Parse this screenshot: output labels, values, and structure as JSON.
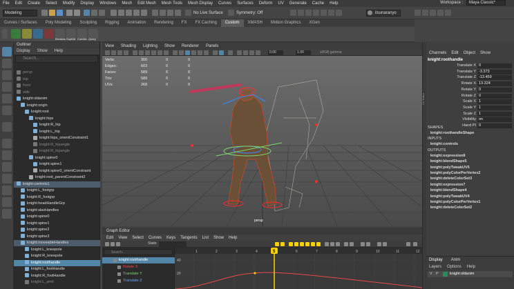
{
  "menubar": {
    "items": [
      "File",
      "Edit",
      "Create",
      "Select",
      "Modify",
      "Display",
      "Windows",
      "Mesh",
      "Edit Mesh",
      "Mesh Tools",
      "Mesh Display",
      "Curves",
      "Surfaces",
      "Deform",
      "UV",
      "Generate",
      "Cache",
      "Help"
    ],
    "workspace_label": "Workspace :",
    "workspace_value": "Maya Classic*"
  },
  "statusline": {
    "mode": "Modeling",
    "live_surface": "No Live Surface",
    "symmetry": "Symmetry: Off",
    "user": "ilsunaranyo"
  },
  "shelf": {
    "tabs": [
      "Curves / Surfaces",
      "Poly Modeling",
      "Sculpting",
      "Rigging",
      "Animation",
      "Rendering",
      "FX",
      "FX Caching",
      "Custom",
      "XMASH",
      "Motion Graphics",
      "XGen"
    ],
    "active_tab": "Custom",
    "icon_labels": [
      "Breakdn",
      "SoptAtt",
      "Combin",
      "Query"
    ]
  },
  "outliner": {
    "title": "Outliner",
    "menu": [
      "Display",
      "Show",
      "Help"
    ],
    "search_placeholder": "Search...",
    "rows": [
      {
        "label": "persp",
        "indent": 0,
        "state": "dim",
        "color": "#777"
      },
      {
        "label": "top",
        "indent": 0,
        "state": "dim",
        "color": "#777"
      },
      {
        "label": "front",
        "indent": 0,
        "state": "dim",
        "color": "#777"
      },
      {
        "label": "side",
        "indent": 0,
        "state": "dim",
        "color": "#777"
      },
      {
        "label": "knight:oldanim",
        "indent": 0,
        "state": "",
        "color": "#7fb0d8"
      },
      {
        "label": "knight:origin",
        "indent": 1,
        "state": "",
        "color": "#7fb0d8"
      },
      {
        "label": "knight:root",
        "indent": 2,
        "state": "",
        "color": "#7fb0d8"
      },
      {
        "label": "knight:hips",
        "indent": 3,
        "state": "",
        "color": "#7fb0d8"
      },
      {
        "label": "knight:R_hip",
        "indent": 4,
        "state": "",
        "color": "#7fb0d8"
      },
      {
        "label": "knight:L_hip",
        "indent": 4,
        "state": "",
        "color": "#7fb0d8"
      },
      {
        "label": "knight:hips_orientConstraint1",
        "indent": 4,
        "state": "",
        "color": "#aaa"
      },
      {
        "label": "knight:R_hipangle",
        "indent": 4,
        "state": "dim",
        "color": "#777"
      },
      {
        "label": "knight:R_hipangle",
        "indent": 4,
        "state": "dim",
        "color": "#777"
      },
      {
        "label": "knight:spine0",
        "indent": 3,
        "state": "",
        "color": "#7fb0d8"
      },
      {
        "label": "knight:spine1",
        "indent": 4,
        "state": "",
        "color": "#7fb0d8"
      },
      {
        "label": "knight:spine0_orientConstraint",
        "indent": 4,
        "state": "",
        "color": "#aaa"
      },
      {
        "label": "knight:root_parentConstraint2",
        "indent": 3,
        "state": "",
        "color": "#aaa"
      },
      {
        "label": "knight:controls1",
        "indent": 0,
        "state": "hl",
        "color": "#7fb0d8"
      },
      {
        "label": "knight:L_footgrp",
        "indent": 1,
        "state": "",
        "color": "#7fb0d8"
      },
      {
        "label": "knight:R_footgrp",
        "indent": 1,
        "state": "",
        "color": "#7fb0d8"
      },
      {
        "label": "knight:headHandleGrp",
        "indent": 1,
        "state": "",
        "color": "#7fb0d8"
      },
      {
        "label": "knight:slavHandles",
        "indent": 1,
        "state": "",
        "color": "#7fb0d8"
      },
      {
        "label": "knight:spine0",
        "indent": 1,
        "state": "",
        "color": "#7fb0d8"
      },
      {
        "label": "knight:spine1",
        "indent": 1,
        "state": "",
        "color": "#7fb0d8"
      },
      {
        "label": "knight:spine2",
        "indent": 1,
        "state": "",
        "color": "#7fb0d8"
      },
      {
        "label": "knight:spine3",
        "indent": 1,
        "state": "",
        "color": "#7fb0d8"
      },
      {
        "label": "knight:moveableHandles",
        "indent": 1,
        "state": "hl",
        "color": "#7fb0d8"
      },
      {
        "label": "knight:L_kneepole",
        "indent": 2,
        "state": "",
        "color": "#7fb0d8"
      },
      {
        "label": "knight:R_kneepole",
        "indent": 2,
        "state": "",
        "color": "#7fb0d8"
      },
      {
        "label": "knight:roothandle",
        "indent": 2,
        "state": "sel",
        "color": "#7fb0d8"
      },
      {
        "label": "knight:L_footHandle",
        "indent": 2,
        "state": "",
        "color": "#7fb0d8"
      },
      {
        "label": "knight:R_footHandle",
        "indent": 2,
        "state": "",
        "color": "#7fb0d8"
      },
      {
        "label": "knight:L_amtl",
        "indent": 2,
        "state": "dim",
        "color": "#777"
      }
    ]
  },
  "viewport": {
    "menu": [
      "View",
      "Shading",
      "Lighting",
      "Show",
      "Renderer",
      "Panels"
    ],
    "color_space": "sRGB gamma",
    "field_a": "0.00",
    "field_b": "1.00",
    "hud": [
      {
        "label": "Verts:",
        "a": "300",
        "b": "0",
        "c": "0"
      },
      {
        "label": "Edges:",
        "a": "603",
        "b": "0",
        "c": "0"
      },
      {
        "label": "Faces:",
        "a": "589",
        "b": "0",
        "c": "0"
      },
      {
        "label": "Tris:",
        "a": "589",
        "b": "0",
        "c": "0"
      },
      {
        "label": "UVs:",
        "a": "268",
        "b": "0",
        "c": "0"
      }
    ],
    "camera": "persp"
  },
  "graph_editor": {
    "title": "Graph Editor",
    "menu": [
      "Edit",
      "View",
      "Select",
      "Curves",
      "Keys",
      "Tangents",
      "List",
      "Show",
      "Help"
    ],
    "stats_label": "Stats",
    "search_placeholder": "Search...",
    "list": [
      {
        "label": "knight:roothandle",
        "color": "#ffffff",
        "state": "sel"
      },
      {
        "label": "Rotate X",
        "color": "#e84a4a",
        "state": ""
      },
      {
        "label": "Translate Y",
        "color": "#7ed86a",
        "state": ""
      },
      {
        "label": "Translate Z",
        "color": "#6aa8ff",
        "state": ""
      }
    ],
    "frame_ticks": [
      "1",
      "2",
      "3",
      "4",
      "5",
      "6",
      "7",
      "8",
      "9",
      "10",
      "11",
      "12"
    ],
    "current_frame": "5",
    "y_ticks": [
      "40",
      "20"
    ]
  },
  "uv_strip_label": "UV Editor",
  "channel_box": {
    "menu": [
      "Channels",
      "Edit",
      "Object",
      "Show"
    ],
    "object_name": "knight:roothandle",
    "attributes": [
      {
        "label": "Translate X",
        "value": "0"
      },
      {
        "label": "Translate Y",
        "value": "-3.373"
      },
      {
        "label": "Translate Z",
        "value": "-13.459"
      },
      {
        "label": "Rotate X",
        "value": "13.324"
      },
      {
        "label": "Rotate Y",
        "value": "0"
      },
      {
        "label": "Rotate Z",
        "value": "0"
      },
      {
        "label": "Scale X",
        "value": "1"
      },
      {
        "label": "Scale Y",
        "value": "1"
      },
      {
        "label": "Scale Z",
        "value": "1"
      },
      {
        "label": "Visibility",
        "value": "on"
      },
      {
        "label": "Hand Pt",
        "value": "0"
      }
    ],
    "shapes_header": "SHAPES",
    "shapes": [
      "knight:roothandleShape"
    ],
    "inputs_header": "INPUTS",
    "inputs": [
      "knight:controls"
    ],
    "outputs_header": "OUTPUTS",
    "outputs": [
      "knight:expression8",
      "knight:blendShape5",
      "knight:polyTweakUV5",
      "knight:polyColorPerVertex2",
      "knight:deleteColorSet3",
      "knight:expression7",
      "knight:blendShape4",
      "knight:polyTweakUV4",
      "knight:polyColorPerVertex1",
      "knight:deleteColorSet2"
    ]
  },
  "layer_panel": {
    "tabs": [
      "Display",
      "Anim"
    ],
    "menu": [
      "Layers",
      "Options",
      "Help"
    ],
    "layer_v": "V",
    "layer_p": "P",
    "layer_name": "knight:oldanim"
  },
  "colors": {
    "accent": "#5285a6",
    "playhead": "#ffd000",
    "rig_blue": "#3a8cff",
    "rig_red": "#ff2a2a"
  }
}
